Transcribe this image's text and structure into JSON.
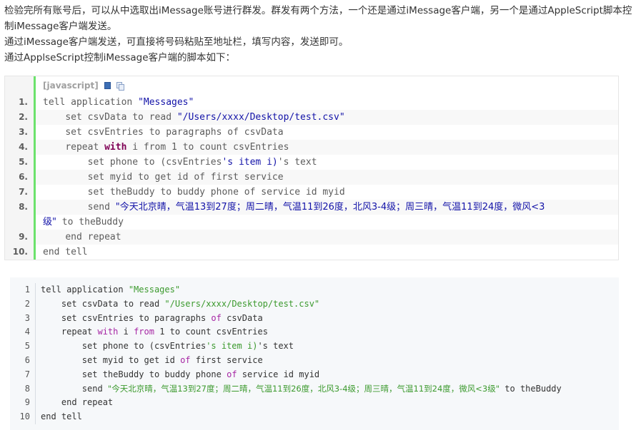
{
  "article": {
    "paragraphs": [
      "检验完所有账号后，可以从中选取出iMessage账号进行群发。群发有两个方法，一个还是通过iMessage客户端，另一个是通过AppleScript脚本控制iMessage客户端发送。",
      "通过iMessage客户端发送，可直接将号码粘贴至地址栏，填写内容，发送即可。",
      "通过ApplseScript控制iMessage客户端的脚本如下："
    ]
  },
  "code_block_1": {
    "language_label": "[javascript]",
    "toolbar_icons": [
      "view-source-icon",
      "copy-icon"
    ],
    "line_numbers": [
      "1.",
      "2.",
      "3.",
      "4.",
      "5.",
      "6.",
      "7.",
      "8.",
      "",
      "9.",
      "10."
    ],
    "lines": [
      {
        "indent": "",
        "parts": [
          [
            "plain",
            "tell application "
          ],
          [
            "str",
            "\"Messages\""
          ]
        ]
      },
      {
        "indent": "    ",
        "parts": [
          [
            "plain",
            "set csvData to read "
          ],
          [
            "str",
            "\"/Users/xxxx/Desktop/test.csv\""
          ]
        ]
      },
      {
        "indent": "    ",
        "parts": [
          [
            "plain",
            "set csvEntries to paragraphs of csvData"
          ]
        ]
      },
      {
        "indent": "    ",
        "parts": [
          [
            "plain",
            "repeat "
          ],
          [
            "kw",
            "with"
          ],
          [
            "plain",
            " i from 1 to count csvEntries"
          ]
        ]
      },
      {
        "indent": "        ",
        "parts": [
          [
            "plain",
            "set phone to (csvEntries"
          ],
          [
            "str",
            "'s item i)"
          ],
          [
            "plain",
            "'s text"
          ]
        ]
      },
      {
        "indent": "        ",
        "parts": [
          [
            "plain",
            "set myid to get id of first service"
          ]
        ]
      },
      {
        "indent": "        ",
        "parts": [
          [
            "plain",
            "set theBuddy to buddy phone of service id myid"
          ]
        ]
      },
      {
        "indent": "        ",
        "parts": [
          [
            "plain",
            "send "
          ],
          [
            "strcjk",
            "\"今天北京晴，气温13到27度；周二晴，气温11到26度，北风3-4级；周三晴，气温11到24度，微风<3"
          ]
        ]
      },
      {
        "indent": "",
        "parts": [
          [
            "strcjk",
            "级\""
          ],
          [
            "plain",
            " to theBuddy"
          ]
        ]
      },
      {
        "indent": "    ",
        "parts": [
          [
            "plain",
            "end repeat"
          ]
        ]
      },
      {
        "indent": "",
        "parts": [
          [
            "plain",
            "end tell"
          ]
        ]
      }
    ]
  },
  "code_block_2": {
    "line_numbers": [
      "1",
      "2",
      "3",
      "4",
      "5",
      "6",
      "7",
      "8",
      "9",
      "10"
    ],
    "lines": [
      {
        "indent": "",
        "parts": [
          [
            "plain",
            "tell application "
          ],
          [
            "str",
            "\"Messages\""
          ]
        ]
      },
      {
        "indent": "    ",
        "parts": [
          [
            "plain",
            "set csvData to read "
          ],
          [
            "str",
            "\"/Users/xxxx/Desktop/test.csv\""
          ]
        ]
      },
      {
        "indent": "    ",
        "parts": [
          [
            "plain",
            "set csvEntries to paragraphs "
          ],
          [
            "kw",
            "of"
          ],
          [
            "plain",
            " csvData"
          ]
        ]
      },
      {
        "indent": "    ",
        "parts": [
          [
            "plain",
            "repeat "
          ],
          [
            "kw",
            "with"
          ],
          [
            "plain",
            " i "
          ],
          [
            "kw",
            "from"
          ],
          [
            "plain",
            " 1 to count csvEntries"
          ]
        ]
      },
      {
        "indent": "        ",
        "parts": [
          [
            "plain",
            "set phone to (csvEntries"
          ],
          [
            "str",
            "'s item i)"
          ],
          [
            "plain",
            "'s text"
          ]
        ]
      },
      {
        "indent": "        ",
        "parts": [
          [
            "plain",
            "set myid to get id "
          ],
          [
            "kw",
            "of"
          ],
          [
            "plain",
            " first service"
          ]
        ]
      },
      {
        "indent": "        ",
        "parts": [
          [
            "plain",
            "set theBuddy to buddy phone "
          ],
          [
            "kw",
            "of"
          ],
          [
            "plain",
            " service id myid"
          ]
        ]
      },
      {
        "indent": "        ",
        "parts": [
          [
            "plain",
            "send "
          ],
          [
            "strcjk",
            "\"今天北京晴，气温13到27度；周二晴，气温11到26度，北风3-4级；周三晴，气温11到24度，微风<3级\""
          ],
          [
            "plain",
            " to theBuddy"
          ]
        ]
      },
      {
        "indent": "    ",
        "parts": [
          [
            "plain",
            "end repeat"
          ]
        ]
      },
      {
        "indent": "",
        "parts": [
          [
            "plain",
            "end tell"
          ]
        ]
      }
    ]
  },
  "colors": {
    "gutter_bar": "#6ce26c",
    "string_block1": "#1313a8",
    "string_block2": "#3c9a2e",
    "keyword_block2": "#a626a4"
  }
}
